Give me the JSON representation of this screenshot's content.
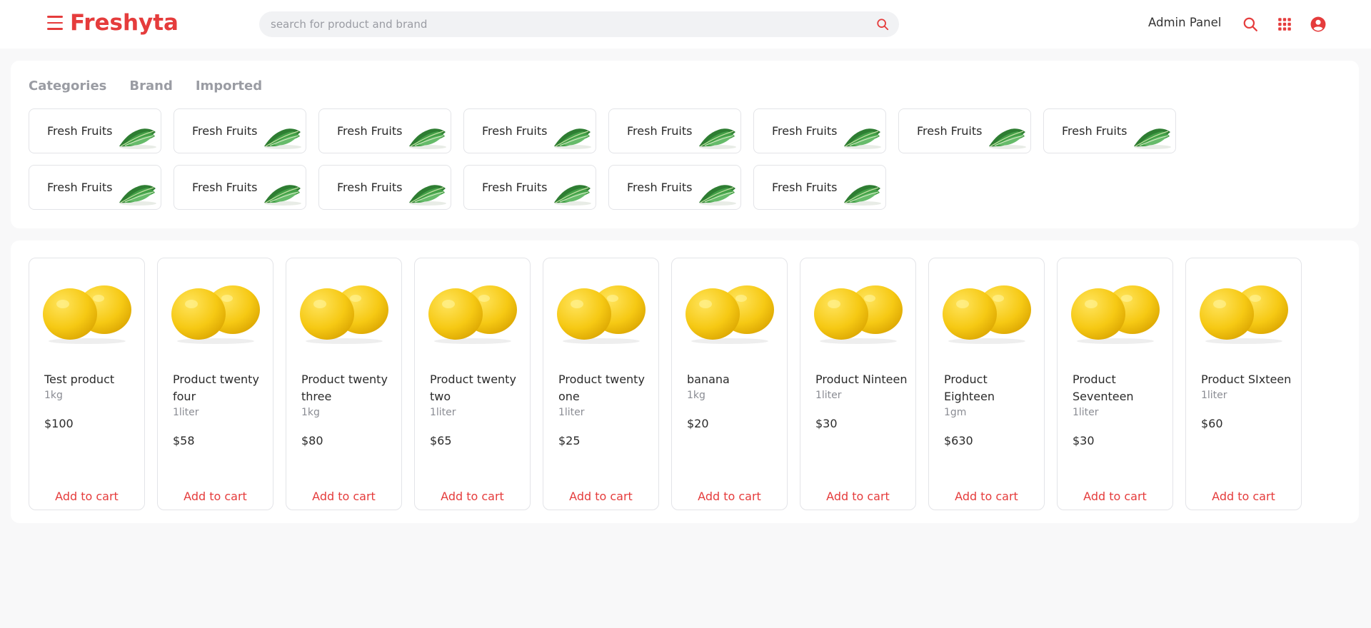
{
  "app": {
    "logo": "Freshyta",
    "brand_color": "#e53c3c"
  },
  "header": {
    "search_placeholder": "search for product and brand",
    "admin_link": "Admin Panel",
    "icons": [
      "menu-icon",
      "search-icon",
      "apps-grid-icon",
      "user-account-icon"
    ]
  },
  "filters": {
    "tabs": [
      "Categories",
      "Brand",
      "Imported"
    ]
  },
  "categories": [
    {
      "label": "Fresh Fruits"
    },
    {
      "label": "Fresh Fruits"
    },
    {
      "label": "Fresh Fruits"
    },
    {
      "label": "Fresh Fruits"
    },
    {
      "label": "Fresh Fruits"
    },
    {
      "label": "Fresh Fruits"
    },
    {
      "label": "Fresh Fruits"
    },
    {
      "label": "Fresh Fruits"
    },
    {
      "label": "Fresh Fruits"
    },
    {
      "label": "Fresh Fruits"
    },
    {
      "label": "Fresh Fruits"
    },
    {
      "label": "Fresh Fruits"
    },
    {
      "label": "Fresh Fruits"
    },
    {
      "label": "Fresh Fruits"
    }
  ],
  "products": [
    {
      "name": "Test product",
      "unit": "1kg",
      "price": "$100",
      "action": "Add to cart"
    },
    {
      "name": "Product twenty four",
      "unit": "1liter",
      "price": "$58",
      "action": "Add to cart"
    },
    {
      "name": "Product twenty three",
      "unit": "1kg",
      "price": "$80",
      "action": "Add to cart"
    },
    {
      "name": "Product twenty two",
      "unit": "1liter",
      "price": "$65",
      "action": "Add to cart"
    },
    {
      "name": "Product twenty one",
      "unit": "1liter",
      "price": "$25",
      "action": "Add to cart"
    },
    {
      "name": "banana",
      "unit": "1kg",
      "price": "$20",
      "action": "Add to cart"
    },
    {
      "name": "Product Ninteen",
      "unit": "1liter",
      "price": "$30",
      "action": "Add to cart"
    },
    {
      "name": "Product Eighteen",
      "unit": "1gm",
      "price": "$630",
      "action": "Add to cart"
    },
    {
      "name": "Product Seventeen",
      "unit": "1liter",
      "price": "$30",
      "action": "Add to cart"
    },
    {
      "name": "Product SIxteen",
      "unit": "1liter",
      "price": "$60",
      "action": "Add to cart"
    }
  ]
}
